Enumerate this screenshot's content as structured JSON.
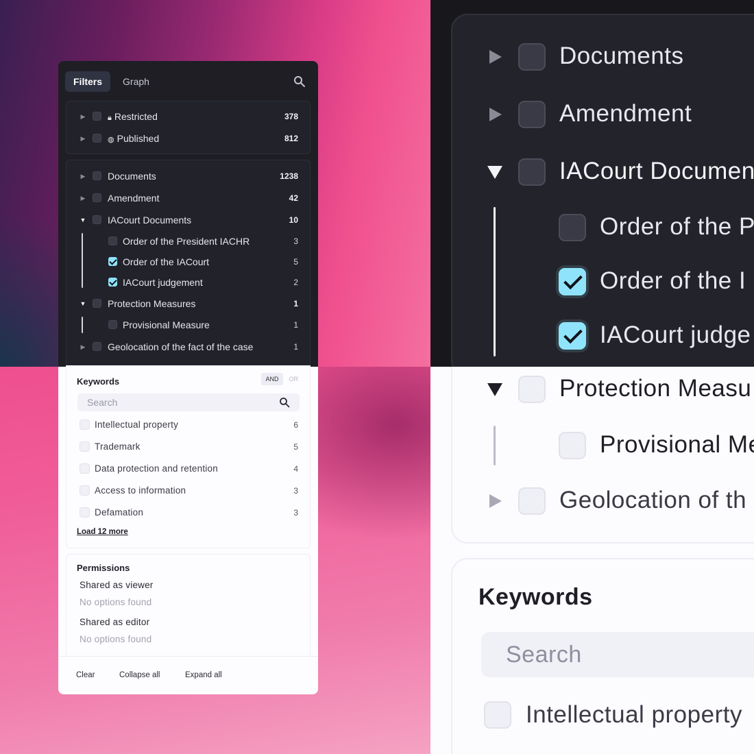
{
  "tabs": [
    {
      "label": "Filters",
      "active": true
    },
    {
      "label": "Graph",
      "active": false
    }
  ],
  "access": [
    {
      "label": "Restricted",
      "icon": "lock-icon",
      "count": "378"
    },
    {
      "label": "Published",
      "icon": "globe-icon",
      "count": "812"
    }
  ],
  "types": [
    {
      "label": "Documents",
      "count": "1238"
    },
    {
      "label": "Amendment",
      "count": "42"
    },
    {
      "label": "IACourt Documents",
      "count": "10"
    },
    {
      "label": "Order of the President IACHR",
      "count": "3"
    },
    {
      "label": "Order of the IACourt",
      "count": "5"
    },
    {
      "label": "IACourt judgement",
      "count": "2"
    },
    {
      "label": "Protection Measures",
      "count": "1"
    },
    {
      "label": "Provisional Measure",
      "count": "1"
    },
    {
      "label": "Geolocation of the fact of the case",
      "count": "1"
    }
  ],
  "keywords": {
    "title": "Keywords",
    "and_label": "AND",
    "or_label": "OR",
    "search_placeholder": "Search",
    "items": [
      {
        "label": "Intellectual property",
        "count": "6"
      },
      {
        "label": "Trademark",
        "count": "5"
      },
      {
        "label": "Data protection and retention",
        "count": "4"
      },
      {
        "label": "Access to information",
        "count": "3"
      },
      {
        "label": "Defamation",
        "count": "3"
      }
    ],
    "load_more": "Load 12 more"
  },
  "permissions": {
    "title": "Permissions",
    "viewer_label": "Shared as viewer",
    "viewer_empty": "No options found",
    "editor_label": "Shared as editor",
    "editor_empty": "No options found"
  },
  "footer": {
    "clear": "Clear",
    "collapse": "Collapse all",
    "expand": "Expand all"
  },
  "zoom": {
    "rows": [
      "Documents",
      "Amendment",
      "IACourt Documen",
      "Order of the P",
      "Order of the I",
      "IACourt judge",
      "Protection Measu",
      "Provisional Me",
      "Geolocation of th"
    ],
    "keywords_title": "Keywords",
    "search_placeholder": "Search",
    "keyword_item": "Intellectual property"
  },
  "colors": {
    "accent": "#8fe4fb",
    "dark_panel": "#1e1e24",
    "light_panel": "#fdfcff",
    "pink": "#f0508e"
  }
}
